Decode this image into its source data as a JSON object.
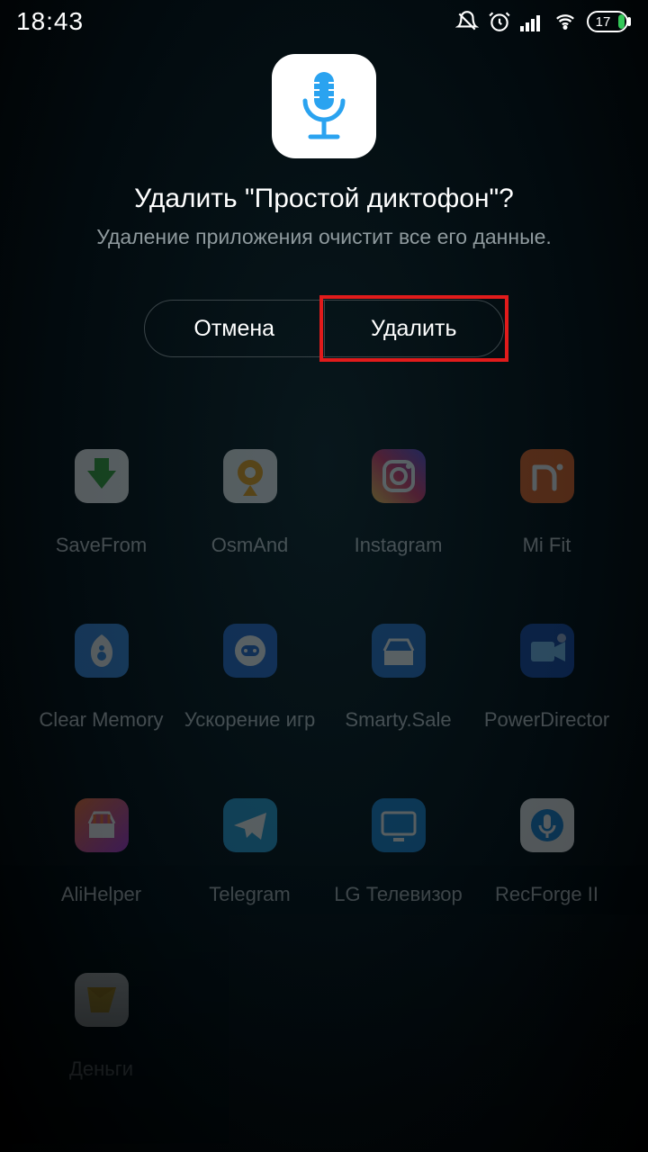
{
  "status": {
    "time": "18:43",
    "battery_percent": "17"
  },
  "dialog": {
    "title": "Удалить \"Простой диктофон\"?",
    "subtitle": "Удаление приложения очистит все его данные.",
    "cancel": "Отмена",
    "confirm": "Удалить"
  },
  "apps": [
    {
      "label": "SaveFrom",
      "icon": "savefrom"
    },
    {
      "label": "OsmAnd",
      "icon": "osmand"
    },
    {
      "label": "Instagram",
      "icon": "instagram"
    },
    {
      "label": "Mi Fit",
      "icon": "mifit"
    },
    {
      "label": "Clear Memory",
      "icon": "clearmem"
    },
    {
      "label": "Ускорение игр",
      "icon": "gameboost"
    },
    {
      "label": "Smarty.Sale",
      "icon": "smartysale"
    },
    {
      "label": "PowerDirector",
      "icon": "powerdirector"
    },
    {
      "label": "AliHelper",
      "icon": "alihelper"
    },
    {
      "label": "Telegram",
      "icon": "telegram"
    },
    {
      "label": "LG Телевизор",
      "icon": "lgtv"
    },
    {
      "label": "RecForge II",
      "icon": "recforge"
    },
    {
      "label": "Деньги",
      "icon": "money"
    }
  ]
}
